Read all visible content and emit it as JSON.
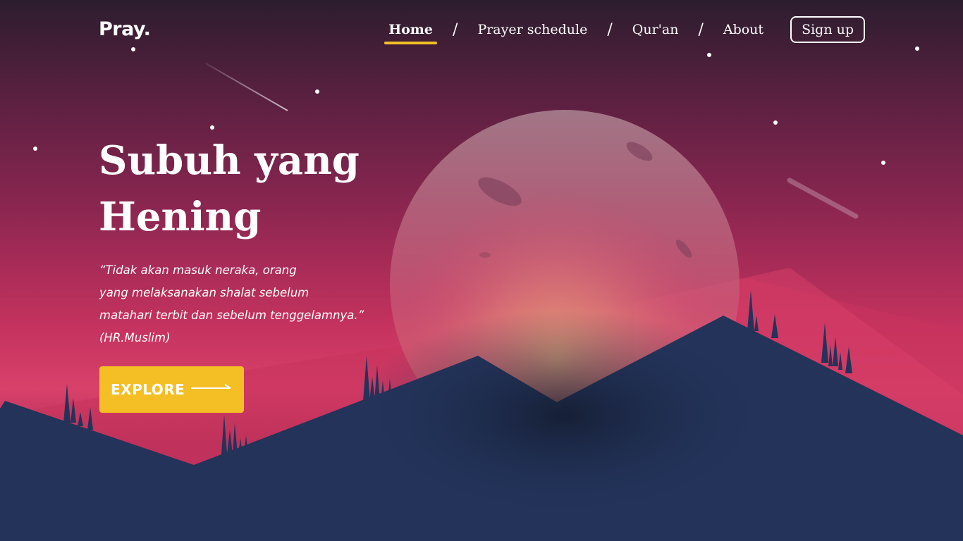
{
  "header": {
    "logo": "Pray.",
    "nav": [
      {
        "label": "Home",
        "active": true
      },
      {
        "label": "Prayer schedule",
        "active": false
      },
      {
        "label": "Qur'an",
        "active": false
      },
      {
        "label": "About",
        "active": false
      }
    ],
    "separator": "/",
    "signup_label": "Sign up"
  },
  "hero": {
    "title": "Subuh yang Hening",
    "quote": "“Tidak akan masuk neraka, orang\n yang melaksanakan shalat sebelum\nmatahari terbit dan sebelum tenggelamnya.”\n(HR.Muslim)",
    "explore_label": "EXPLORE",
    "explore_icon": "arrow-right-icon"
  },
  "colors": {
    "accent": "#f3bf25",
    "mountain": "#23335a",
    "sky_top": "#2c1d2e",
    "sky_mid": "#c4325e"
  }
}
